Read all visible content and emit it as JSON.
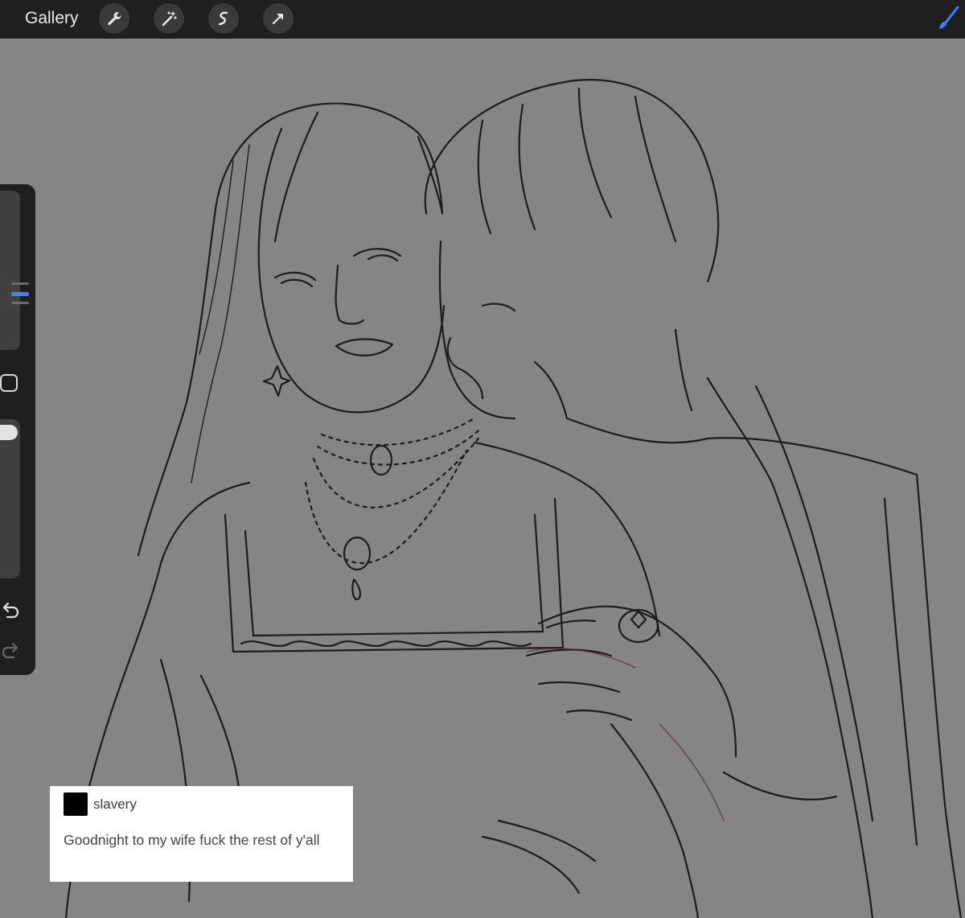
{
  "toolbar": {
    "gallery_label": "Gallery",
    "tools": [
      "wrench-icon",
      "magic-wand-icon",
      "selection-icon",
      "transform-arrow-icon"
    ],
    "active_tool": "brush-icon",
    "accent_color": "#3c82ff"
  },
  "sidebar": {
    "size_slider_level": 0.7,
    "opacity_slider_level": 1.0,
    "buttons": [
      "modify-button",
      "undo-button",
      "redo-button"
    ]
  },
  "post": {
    "username": "slavery",
    "text": "Goodnight to my wife fuck the rest of y'all"
  }
}
